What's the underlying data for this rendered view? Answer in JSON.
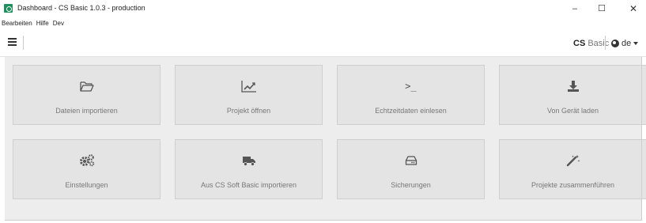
{
  "window": {
    "title": "Dashboard - CS Basic 1.0.3 - production",
    "minimize": "–",
    "maximize": "☐",
    "close": "✕"
  },
  "menu": [
    "Bearbeiten",
    "Hilfe",
    "Dev"
  ],
  "toolbar": {
    "menu_icon": "hamburger-icon",
    "brand_bold": "CS",
    "brand_rest": "Basic",
    "language": "de"
  },
  "tiles": [
    {
      "label": "Dateien importieren",
      "icon": "folder-open-icon"
    },
    {
      "label": "Projekt öffnen",
      "icon": "line-chart-icon"
    },
    {
      "label": "Echtzeitdaten einlesen",
      "icon": "terminal-icon",
      "glyph": ">_"
    },
    {
      "label": "Von Gerät laden",
      "icon": "download-icon"
    },
    {
      "label": "Einstellungen",
      "icon": "gears-icon"
    },
    {
      "label": "Aus CS Soft Basic importieren",
      "icon": "truck-icon"
    },
    {
      "label": "Sicherungen",
      "icon": "hard-drive-icon"
    },
    {
      "label": "Projekte zusammenführen",
      "icon": "magic-wand-icon"
    }
  ],
  "colors": {
    "app_icon": "#1e8f5f",
    "tile_bg": "#e4e4e4",
    "tile_text": "#777777",
    "icon": "#555555"
  }
}
